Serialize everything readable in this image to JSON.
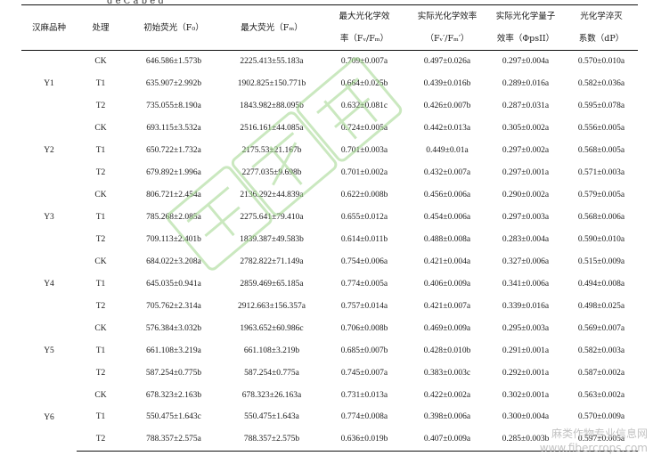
{
  "caption_fragment": "g  e  C  a  p  e  g",
  "headers": {
    "variety": "汉麻品种",
    "treatment": "处理",
    "f0": [
      "初始荧光（F₀）"
    ],
    "fm": [
      "最大荧光（Fₘ）"
    ],
    "fvfm": [
      "最大光化学效",
      "率（Fᵥ/Fₘ）"
    ],
    "fvfm_actual": [
      "实际光化学效率",
      "（Fᵥ′/Fₘ′）"
    ],
    "phipsii": [
      "实际光化学量子",
      "效率（ΦpsII）"
    ],
    "dp": [
      "光化学淬灭",
      "系数（dP）"
    ]
  },
  "groups": [
    {
      "variety": "Y1",
      "rows": [
        {
          "treatment": "CK",
          "f0": "646.586±1.573b",
          "fm": "2225.413±55.183a",
          "fvfm": "0.709±0.007a",
          "fvfm_actual": "0.497±0.026a",
          "phipsii": "0.297±0.004a",
          "dp": "0.570±0.010a"
        },
        {
          "treatment": "T1",
          "f0": "635.907±2.992b",
          "fm": "1902.825±150.771b",
          "fvfm": "0.664±0.025b",
          "fvfm_actual": "0.439±0.016b",
          "phipsii": "0.289±0.016a",
          "dp": "0.582±0.036a"
        },
        {
          "treatment": "T2",
          "f0": "735.055±8.190a",
          "fm": "1843.982±88.095b",
          "fvfm": "0.632±0.081c",
          "fvfm_actual": "0.426±0.007b",
          "phipsii": "0.287±0.031a",
          "dp": "0.595±0.078a"
        }
      ]
    },
    {
      "variety": "Y2",
      "rows": [
        {
          "treatment": "CK",
          "f0": "693.115±3.532a",
          "fm": "2516.161±44.085a",
          "fvfm": "0.724±0.005a",
          "fvfm_actual": "0.442±0.013a",
          "phipsii": "0.305±0.002a",
          "dp": "0.556±0.005a"
        },
        {
          "treatment": "T1",
          "f0": "650.722±1.732a",
          "fm": "2175.53±21.167b",
          "fvfm": "0.701±0.003a",
          "fvfm_actual": "0.449±0.01a",
          "phipsii": "0.297±0.002a",
          "dp": "0.568±0.005a"
        },
        {
          "treatment": "T2",
          "f0": "679.892±1.996a",
          "fm": "2277.035±9.698b",
          "fvfm": "0.701±0.002a",
          "fvfm_actual": "0.432±0.007a",
          "phipsii": "0.297±0.001a",
          "dp": "0.571±0.003a"
        }
      ]
    },
    {
      "variety": "Y3",
      "rows": [
        {
          "treatment": "CK",
          "f0": "806.721±2.454a",
          "fm": "2136.292±44.839a",
          "fvfm": "0.622±0.008b",
          "fvfm_actual": "0.456±0.006a",
          "phipsii": "0.290±0.002a",
          "dp": "0.579±0.005a"
        },
        {
          "treatment": "T1",
          "f0": "785.268±2.085a",
          "fm": "2275.641±79.410a",
          "fvfm": "0.655±0.012a",
          "fvfm_actual": "0.454±0.006a",
          "phipsii": "0.297±0.003a",
          "dp": "0.568±0.006a"
        },
        {
          "treatment": "T2",
          "f0": "709.113±2.401b",
          "fm": "1839.387±49.583b",
          "fvfm": "0.614±0.011b",
          "fvfm_actual": "0.488±0.008a",
          "phipsii": "0.283±0.004a",
          "dp": "0.590±0.010a"
        }
      ]
    },
    {
      "variety": "Y4",
      "rows": [
        {
          "treatment": "CK",
          "f0": "684.022±3.208a",
          "fm": "2782.822±71.149a",
          "fvfm": "0.754±0.006a",
          "fvfm_actual": "0.421±0.004a",
          "phipsii": "0.327±0.006a",
          "dp": "0.515±0.009a"
        },
        {
          "treatment": "T1",
          "f0": "645.035±0.941a",
          "fm": "2859.469±65.185a",
          "fvfm": "0.774±0.005a",
          "fvfm_actual": "0.406±0.009a",
          "phipsii": "0.341±0.006a",
          "dp": "0.494±0.008a"
        },
        {
          "treatment": "T2",
          "f0": "705.762±2.314a",
          "fm": "2912.663±156.357a",
          "fvfm": "0.757±0.014a",
          "fvfm_actual": "0.421±0.007a",
          "phipsii": "0.339±0.016a",
          "dp": "0.498±0.025a"
        }
      ]
    },
    {
      "variety": "Y5",
      "rows": [
        {
          "treatment": "CK",
          "f0": "576.384±3.032b",
          "fm": "1963.652±60.986c",
          "fvfm": "0.706±0.008b",
          "fvfm_actual": "0.469±0.009a",
          "phipsii": "0.295±0.003a",
          "dp": "0.569±0.007a"
        },
        {
          "treatment": "T1",
          "f0": "661.108±3.219a",
          "fm": "661.108±3.219b",
          "fvfm": "0.685±0.007b",
          "fvfm_actual": "0.428±0.010b",
          "phipsii": "0.291±0.001a",
          "dp": "0.582±0.003a"
        },
        {
          "treatment": "T2",
          "f0": "587.254±0.775b",
          "fm": "587.254±0.775a",
          "fvfm": "0.745±0.007a",
          "fvfm_actual": "0.383±0.003c",
          "phipsii": "0.292±0.001a",
          "dp": "0.587±0.002a"
        }
      ]
    },
    {
      "variety": "Y6",
      "rows": [
        {
          "treatment": "CK",
          "f0": "678.323±2.163b",
          "fm": "678.323±26.163a",
          "fvfm": "0.731±0.013a",
          "fvfm_actual": "0.422±0.002a",
          "phipsii": "0.302±0.001a",
          "dp": "0.563±0.002a"
        },
        {
          "treatment": "T1",
          "f0": "550.475±1.643c",
          "fm": "550.475±1.643a",
          "fvfm": "0.774±0.008a",
          "fvfm_actual": "0.398±0.006a",
          "phipsii": "0.300±0.004a",
          "dp": "0.570±0.009a"
        },
        {
          "treatment": "T2",
          "f0": "788.357±2.575a",
          "fm": "788.357±2.575b",
          "fvfm": "0.636±0.019b",
          "fvfm_actual": "0.407±0.009a",
          "phipsii": "0.285±0.003b",
          "dp": "0.597±0.005a"
        }
      ]
    }
  ],
  "watermark_text": "鑫和林",
  "site_mark": [
    "麻类作物专业信息网",
    "www.fibercrops.com"
  ]
}
